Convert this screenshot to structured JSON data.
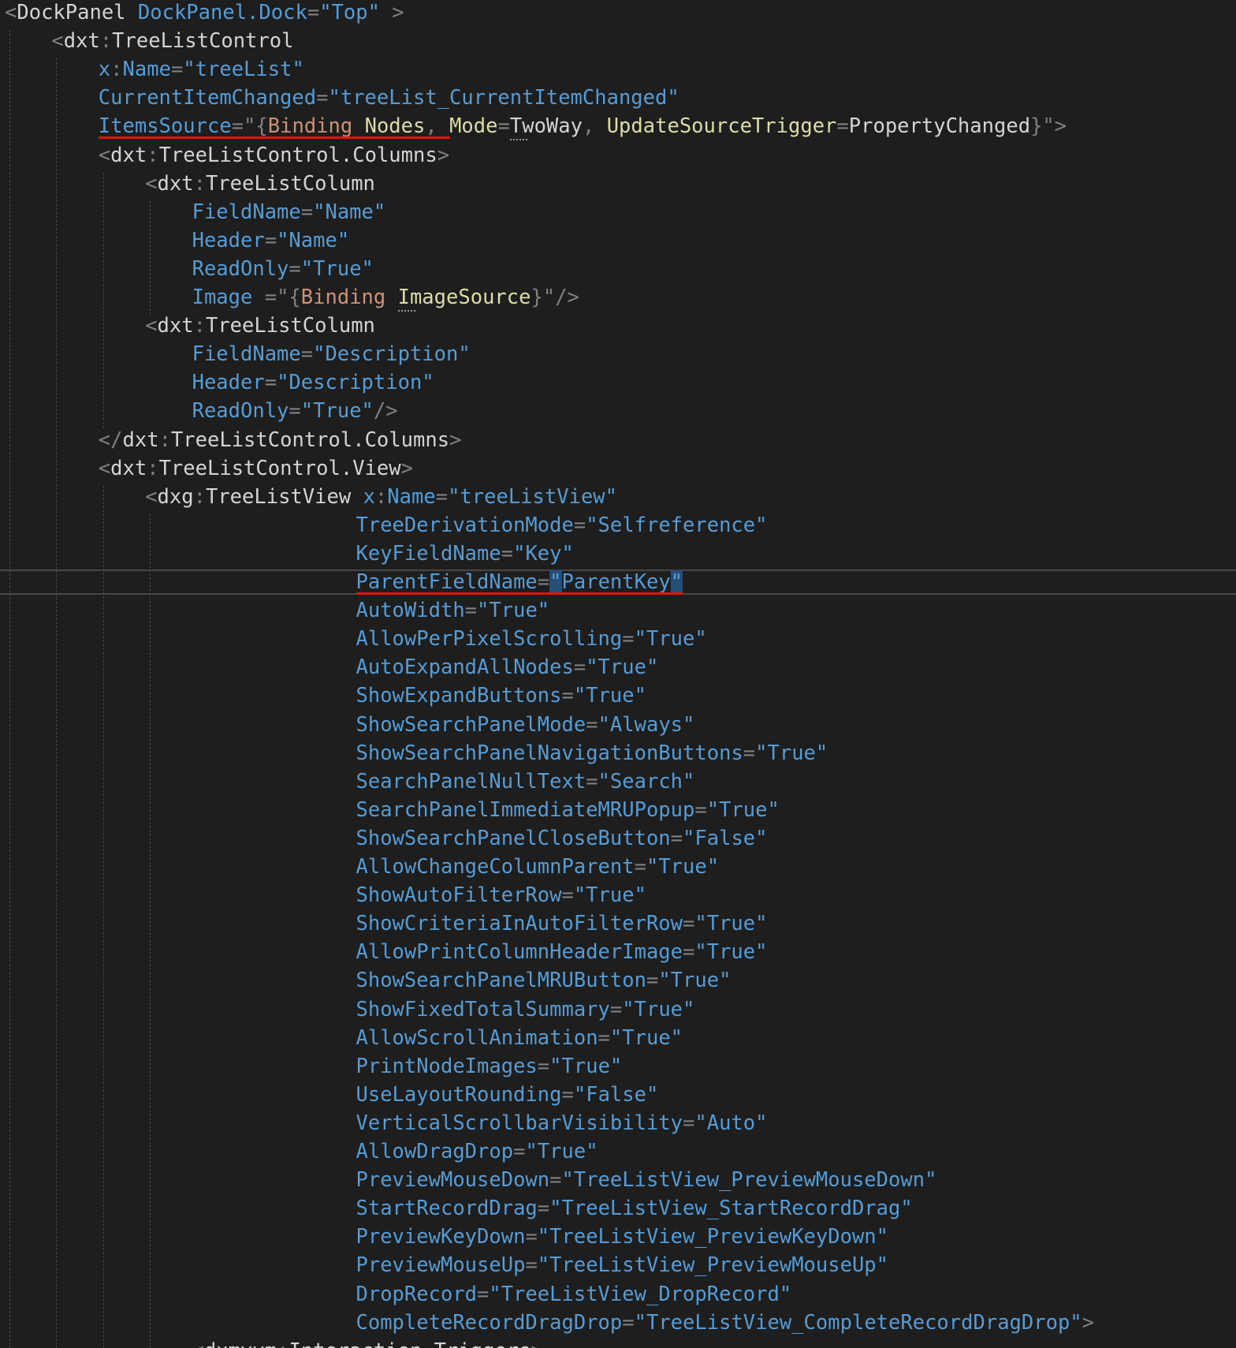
{
  "lines": [
    {
      "indent": 0,
      "tokens": [
        [
          "<",
          "t-punct"
        ],
        [
          "DockPanel",
          "t-elem"
        ],
        [
          " DockPanel.Dock",
          "t-attr"
        ],
        [
          "=",
          "t-punct"
        ],
        [
          "\"Top\"",
          "t-val"
        ],
        [
          " >",
          "t-punct"
        ]
      ]
    },
    {
      "indent": 4,
      "tokens": [
        [
          "<",
          "t-punct"
        ],
        [
          "dxt",
          "t-ns"
        ],
        [
          ":",
          "t-punct"
        ],
        [
          "TreeListControl",
          "t-elem"
        ]
      ]
    },
    {
      "indent": 8,
      "tokens": [
        [
          "x",
          "t-attr"
        ],
        [
          ":",
          "t-punct"
        ],
        [
          "Name",
          "t-attr"
        ],
        [
          "=",
          "t-punct"
        ],
        [
          "\"treeList\"",
          "t-val"
        ]
      ]
    },
    {
      "indent": 8,
      "tokens": [
        [
          "CurrentItemChanged",
          "t-attr"
        ],
        [
          "=",
          "t-punct"
        ],
        [
          "\"treeList_CurrentItemChanged\"",
          "t-val"
        ]
      ]
    },
    {
      "indent": 8,
      "tokens": [
        [
          "ItemsSource",
          "t-attr"
        ],
        [
          "=",
          "t-punct"
        ],
        [
          "\"{",
          "t-punct"
        ],
        [
          "Binding",
          "t-ext"
        ],
        [
          " Nodes",
          "t-prop"
        ],
        [
          ", ",
          "t-punct"
        ],
        [
          "Mode",
          "t-prop"
        ],
        [
          "=",
          "t-punct"
        ],
        [
          "TwoWay",
          "t-ext-text"
        ],
        [
          ", ",
          "t-punct"
        ],
        [
          "UpdateSourceTrigger",
          "t-prop"
        ],
        [
          "=",
          "t-punct"
        ],
        [
          "PropertyChanged",
          "t-ext-text"
        ],
        [
          "}\"",
          "t-punct"
        ],
        [
          ">",
          "t-punct"
        ]
      ]
    },
    {
      "indent": 8,
      "tokens": [
        [
          "<",
          "t-punct"
        ],
        [
          "dxt",
          "t-ns"
        ],
        [
          ":",
          "t-punct"
        ],
        [
          "TreeListControl.Columns",
          "t-elem"
        ],
        [
          ">",
          "t-punct"
        ]
      ]
    },
    {
      "indent": 12,
      "tokens": [
        [
          "<",
          "t-punct"
        ],
        [
          "dxt",
          "t-ns"
        ],
        [
          ":",
          "t-punct"
        ],
        [
          "TreeListColumn",
          "t-elem"
        ]
      ]
    },
    {
      "indent": 16,
      "tokens": [
        [
          "FieldName",
          "t-attr"
        ],
        [
          "=",
          "t-punct"
        ],
        [
          "\"Name\"",
          "t-val"
        ]
      ]
    },
    {
      "indent": 16,
      "tokens": [
        [
          "Header",
          "t-attr"
        ],
        [
          "=",
          "t-punct"
        ],
        [
          "\"Name\"",
          "t-val"
        ]
      ]
    },
    {
      "indent": 16,
      "tokens": [
        [
          "ReadOnly",
          "t-attr"
        ],
        [
          "=",
          "t-punct"
        ],
        [
          "\"True\"",
          "t-val"
        ]
      ]
    },
    {
      "indent": 16,
      "tokens": [
        [
          "Image",
          "t-attr"
        ],
        [
          " =\"{",
          "t-punct"
        ],
        [
          "Binding",
          "t-ext"
        ],
        [
          " ImageSource",
          "t-prop"
        ],
        [
          "}\"/>",
          "t-punct"
        ]
      ]
    },
    {
      "indent": 12,
      "tokens": [
        [
          "<",
          "t-punct"
        ],
        [
          "dxt",
          "t-ns"
        ],
        [
          ":",
          "t-punct"
        ],
        [
          "TreeListColumn",
          "t-elem"
        ]
      ]
    },
    {
      "indent": 16,
      "tokens": [
        [
          "FieldName",
          "t-attr"
        ],
        [
          "=",
          "t-punct"
        ],
        [
          "\"Description\"",
          "t-val"
        ]
      ]
    },
    {
      "indent": 16,
      "tokens": [
        [
          "Header",
          "t-attr"
        ],
        [
          "=",
          "t-punct"
        ],
        [
          "\"Description\"",
          "t-val"
        ]
      ]
    },
    {
      "indent": 16,
      "tokens": [
        [
          "ReadOnly",
          "t-attr"
        ],
        [
          "=",
          "t-punct"
        ],
        [
          "\"True\"",
          "t-val"
        ],
        [
          "/>",
          "t-punct"
        ]
      ]
    },
    {
      "indent": 8,
      "tokens": [
        [
          "</",
          "t-punct"
        ],
        [
          "dxt",
          "t-ns"
        ],
        [
          ":",
          "t-punct"
        ],
        [
          "TreeListControl.Columns",
          "t-elem"
        ],
        [
          ">",
          "t-punct"
        ]
      ]
    },
    {
      "indent": 8,
      "tokens": [
        [
          "<",
          "t-punct"
        ],
        [
          "dxt",
          "t-ns"
        ],
        [
          ":",
          "t-punct"
        ],
        [
          "TreeListControl.View",
          "t-elem"
        ],
        [
          ">",
          "t-punct"
        ]
      ]
    },
    {
      "indent": 12,
      "tokens": [
        [
          "<",
          "t-punct"
        ],
        [
          "dxg",
          "t-ns"
        ],
        [
          ":",
          "t-punct"
        ],
        [
          "TreeListView ",
          "t-elem"
        ],
        [
          "x",
          "t-attr"
        ],
        [
          ":",
          "t-punct"
        ],
        [
          "Name",
          "t-attr"
        ],
        [
          "=",
          "t-punct"
        ],
        [
          "\"treeListView\"",
          "t-val"
        ]
      ]
    },
    {
      "indent": 30,
      "tokens": [
        [
          "TreeDerivationMode",
          "t-attr"
        ],
        [
          "=",
          "t-punct"
        ],
        [
          "\"Selfreference\"",
          "t-val"
        ]
      ]
    },
    {
      "indent": 30,
      "tokens": [
        [
          "KeyFieldName",
          "t-attr"
        ],
        [
          "=",
          "t-punct"
        ],
        [
          "\"Key\"",
          "t-val"
        ]
      ]
    },
    {
      "indent": 30,
      "tokens": [
        [
          "ParentFieldName",
          "t-attr"
        ],
        [
          "=",
          "t-punct"
        ],
        [
          "\"",
          "t-val",
          "sel"
        ],
        [
          "ParentKey",
          "t-val"
        ],
        [
          "\"",
          "t-val",
          "sel"
        ]
      ]
    },
    {
      "indent": 30,
      "tokens": [
        [
          "AutoWidth",
          "t-attr"
        ],
        [
          "=",
          "t-punct"
        ],
        [
          "\"True\"",
          "t-val"
        ]
      ]
    },
    {
      "indent": 30,
      "tokens": [
        [
          "AllowPerPixelScrolling",
          "t-attr"
        ],
        [
          "=",
          "t-punct"
        ],
        [
          "\"True\"",
          "t-val"
        ]
      ]
    },
    {
      "indent": 30,
      "tokens": [
        [
          "AutoExpandAllNodes",
          "t-attr"
        ],
        [
          "=",
          "t-punct"
        ],
        [
          "\"True\"",
          "t-val"
        ]
      ]
    },
    {
      "indent": 30,
      "tokens": [
        [
          "ShowExpandButtons",
          "t-attr"
        ],
        [
          "=",
          "t-punct"
        ],
        [
          "\"True\"",
          "t-val"
        ]
      ]
    },
    {
      "indent": 30,
      "tokens": [
        [
          "ShowSearchPanelMode",
          "t-attr"
        ],
        [
          "=",
          "t-punct"
        ],
        [
          "\"Always\"",
          "t-val"
        ]
      ]
    },
    {
      "indent": 30,
      "tokens": [
        [
          "ShowSearchPanelNavigationButtons",
          "t-attr"
        ],
        [
          "=",
          "t-punct"
        ],
        [
          "\"True\"",
          "t-val"
        ]
      ]
    },
    {
      "indent": 30,
      "tokens": [
        [
          "SearchPanelNullText",
          "t-attr"
        ],
        [
          "=",
          "t-punct"
        ],
        [
          "\"Search\"",
          "t-val"
        ]
      ]
    },
    {
      "indent": 30,
      "tokens": [
        [
          "SearchPanelImmediateMRUPopup",
          "t-attr"
        ],
        [
          "=",
          "t-punct"
        ],
        [
          "\"True\"",
          "t-val"
        ]
      ]
    },
    {
      "indent": 30,
      "tokens": [
        [
          "ShowSearchPanelCloseButton",
          "t-attr"
        ],
        [
          "=",
          "t-punct"
        ],
        [
          "\"False\"",
          "t-val"
        ]
      ]
    },
    {
      "indent": 30,
      "tokens": [
        [
          "AllowChangeColumnParent",
          "t-attr"
        ],
        [
          "=",
          "t-punct"
        ],
        [
          "\"True\"",
          "t-val"
        ]
      ]
    },
    {
      "indent": 30,
      "tokens": [
        [
          "ShowAutoFilterRow",
          "t-attr"
        ],
        [
          "=",
          "t-punct"
        ],
        [
          "\"True\"",
          "t-val"
        ]
      ]
    },
    {
      "indent": 30,
      "tokens": [
        [
          "ShowCriteriaInAutoFilterRow",
          "t-attr"
        ],
        [
          "=",
          "t-punct"
        ],
        [
          "\"True\"",
          "t-val"
        ]
      ]
    },
    {
      "indent": 30,
      "tokens": [
        [
          "AllowPrintColumnHeaderImage",
          "t-attr"
        ],
        [
          "=",
          "t-punct"
        ],
        [
          "\"True\"",
          "t-val"
        ]
      ]
    },
    {
      "indent": 30,
      "tokens": [
        [
          "ShowSearchPanelMRUButton",
          "t-attr"
        ],
        [
          "=",
          "t-punct"
        ],
        [
          "\"True\"",
          "t-val"
        ]
      ]
    },
    {
      "indent": 30,
      "tokens": [
        [
          "ShowFixedTotalSummary",
          "t-attr"
        ],
        [
          "=",
          "t-punct"
        ],
        [
          "\"True\"",
          "t-val"
        ]
      ]
    },
    {
      "indent": 30,
      "tokens": [
        [
          "AllowScrollAnimation",
          "t-attr"
        ],
        [
          "=",
          "t-punct"
        ],
        [
          "\"True\"",
          "t-val"
        ]
      ]
    },
    {
      "indent": 30,
      "tokens": [
        [
          "PrintNodeImages",
          "t-attr"
        ],
        [
          "=",
          "t-punct"
        ],
        [
          "\"True\"",
          "t-val"
        ]
      ]
    },
    {
      "indent": 30,
      "tokens": [
        [
          "UseLayoutRounding",
          "t-attr"
        ],
        [
          "=",
          "t-punct"
        ],
        [
          "\"False\"",
          "t-val"
        ]
      ]
    },
    {
      "indent": 30,
      "tokens": [
        [
          "VerticalScrollbarVisibility",
          "t-attr"
        ],
        [
          "=",
          "t-punct"
        ],
        [
          "\"Auto\"",
          "t-val"
        ]
      ]
    },
    {
      "indent": 30,
      "tokens": [
        [
          "AllowDragDrop",
          "t-attr"
        ],
        [
          "=",
          "t-punct"
        ],
        [
          "\"True\"",
          "t-val"
        ]
      ]
    },
    {
      "indent": 30,
      "tokens": [
        [
          "PreviewMouseDown",
          "t-attr"
        ],
        [
          "=",
          "t-punct"
        ],
        [
          "\"TreeListView_PreviewMouseDown\"",
          "t-val"
        ]
      ]
    },
    {
      "indent": 30,
      "tokens": [
        [
          "StartRecordDrag",
          "t-attr"
        ],
        [
          "=",
          "t-punct"
        ],
        [
          "\"TreeListView_StartRecordDrag\"",
          "t-val"
        ]
      ]
    },
    {
      "indent": 30,
      "tokens": [
        [
          "PreviewKeyDown",
          "t-attr"
        ],
        [
          "=",
          "t-punct"
        ],
        [
          "\"TreeListView_PreviewKeyDown\"",
          "t-val"
        ]
      ]
    },
    {
      "indent": 30,
      "tokens": [
        [
          "PreviewMouseUp",
          "t-attr"
        ],
        [
          "=",
          "t-punct"
        ],
        [
          "\"TreeListView_PreviewMouseUp\"",
          "t-val"
        ]
      ]
    },
    {
      "indent": 30,
      "tokens": [
        [
          "DropRecord",
          "t-attr"
        ],
        [
          "=",
          "t-punct"
        ],
        [
          "\"TreeListView_DropRecord\"",
          "t-val"
        ]
      ]
    },
    {
      "indent": 30,
      "tokens": [
        [
          "CompleteRecordDragDrop",
          "t-attr"
        ],
        [
          "=",
          "t-punct"
        ],
        [
          "\"TreeListView_CompleteRecordDragDrop\"",
          "t-val"
        ],
        [
          ">",
          "t-punct"
        ]
      ]
    },
    {
      "indent": 16,
      "tokens": [
        [
          "<",
          "t-punct"
        ],
        [
          "dxmvvm",
          "t-ns"
        ],
        [
          ":",
          "t-punct"
        ],
        [
          "Interaction.Triggers",
          "t-elem"
        ],
        [
          ">",
          "t-punct"
        ]
      ]
    }
  ],
  "colors": {
    "background": "#1e1e1e",
    "attribute": "#569cd6",
    "value": "#569cd6",
    "punctuation": "#808080",
    "element": "#d4d4d4",
    "markup_extension": "#ce9178",
    "binding_property": "#dcdcaa",
    "error_squiggle": "#e51400",
    "selection": "#264f78"
  }
}
